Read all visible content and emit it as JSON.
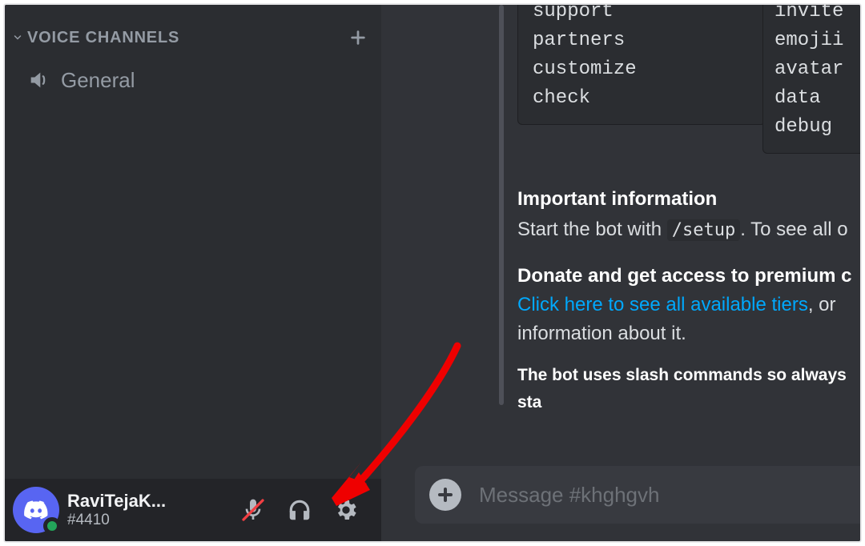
{
  "sidebar": {
    "category_label": "VOICE CHANNELS",
    "voice_channel": "General"
  },
  "userbar": {
    "username": "RaviTejaK...",
    "discriminator": "#4410"
  },
  "message": {
    "code_left": [
      "support",
      "partners",
      "customize",
      "check"
    ],
    "code_right": [
      "invite",
      "emojii",
      "avatar",
      "data",
      "debug"
    ],
    "heading1": "Important information",
    "line1_pre": "Start the bot with ",
    "line1_code": "/setup",
    "line1_post": ". To see all o",
    "heading2": "Donate and get access to premium c",
    "link_text": "Click here to see all available tiers",
    "line2_post": ", or ",
    "line3": "information about it.",
    "footer": "The bot uses slash commands so always sta"
  },
  "composer": {
    "placeholder": "Message #khghgvh"
  }
}
